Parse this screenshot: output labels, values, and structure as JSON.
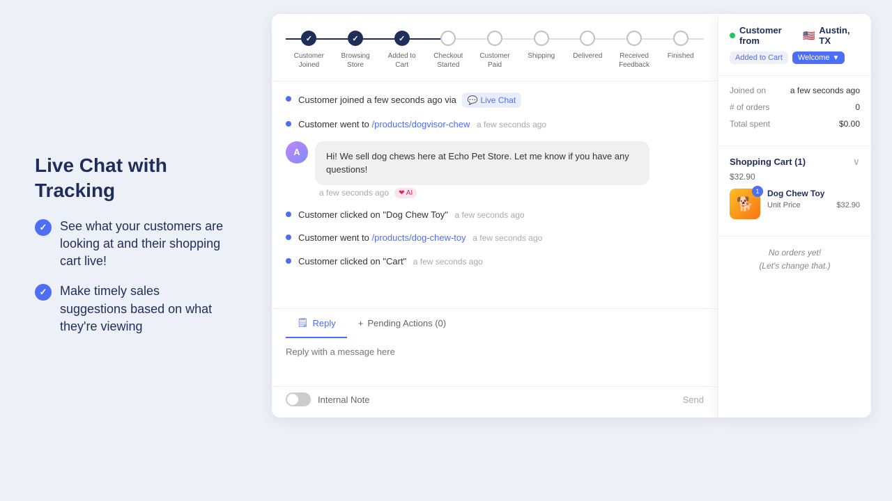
{
  "left": {
    "title": "Live Chat with Tracking",
    "features": [
      "See what your customers are looking at and their shopping cart live!",
      "Make timely sales suggestions based on what they're viewing"
    ]
  },
  "progress": {
    "steps": [
      {
        "label": "Customer\nJoined",
        "state": "completed"
      },
      {
        "label": "Browsing\nStore",
        "state": "completed"
      },
      {
        "label": "Added to\nCart",
        "state": "completed"
      },
      {
        "label": "Checkout\nStarted",
        "state": "inactive"
      },
      {
        "label": "Customer\nPaid",
        "state": "inactive"
      },
      {
        "label": "Shipping",
        "state": "inactive"
      },
      {
        "label": "Delivered",
        "state": "inactive"
      },
      {
        "label": "Received\nFeedback",
        "state": "inactive"
      },
      {
        "label": "Finished",
        "state": "inactive"
      }
    ]
  },
  "chat": {
    "events": [
      {
        "type": "event",
        "text": "Customer joined a few seconds ago via",
        "link": null,
        "icon": "chat",
        "channel": "Live Chat",
        "time": null
      },
      {
        "type": "event",
        "text": "Customer went to",
        "link": "/products/dogvisor-chew",
        "time": "a few seconds ago"
      },
      {
        "type": "message",
        "text": "Hi! We sell dog chews here at Echo Pet Store. Let me know if you have any questions!",
        "time": "a few seconds ago",
        "ai": true
      },
      {
        "type": "event",
        "text": "Customer clicked on \"Dog Chew Toy\"",
        "link": null,
        "time": "a few seconds ago"
      },
      {
        "type": "event",
        "text": "Customer went to",
        "link": "/products/dog-chew-toy",
        "time": "a few seconds ago"
      },
      {
        "type": "event",
        "text": "Customer clicked on \"Cart\"",
        "link": null,
        "time": "a few seconds ago"
      }
    ],
    "tabs": {
      "reply_label": "Reply",
      "pending_label": "Pending Actions (0)",
      "pending_count": 0
    },
    "input_placeholder": "Reply with a message here",
    "toggle_label": "Internal Note",
    "send_label": "Send"
  },
  "customer": {
    "title": "Customer from",
    "location": "Austin, TX",
    "flag": "🇺🇸",
    "status": "online",
    "badges": [
      {
        "label": "Added to Cart",
        "type": "default"
      },
      {
        "label": "Welcome",
        "type": "primary"
      }
    ],
    "info": {
      "joined_label": "Joined on",
      "joined_value": "a few seconds ago",
      "orders_label": "# of orders",
      "orders_value": "0",
      "spent_label": "Total spent",
      "spent_value": "$0.00"
    },
    "cart": {
      "title": "Shopping Cart (1)",
      "total": "$32.90",
      "items": [
        {
          "name": "Dog Chew Toy",
          "quantity": 1,
          "unit_price_label": "Unit Price",
          "unit_price": "$32.90",
          "emoji": "🐶"
        }
      ]
    },
    "orders": {
      "empty_line1": "No orders yet!",
      "empty_line2": "(Let's change that.)"
    }
  }
}
